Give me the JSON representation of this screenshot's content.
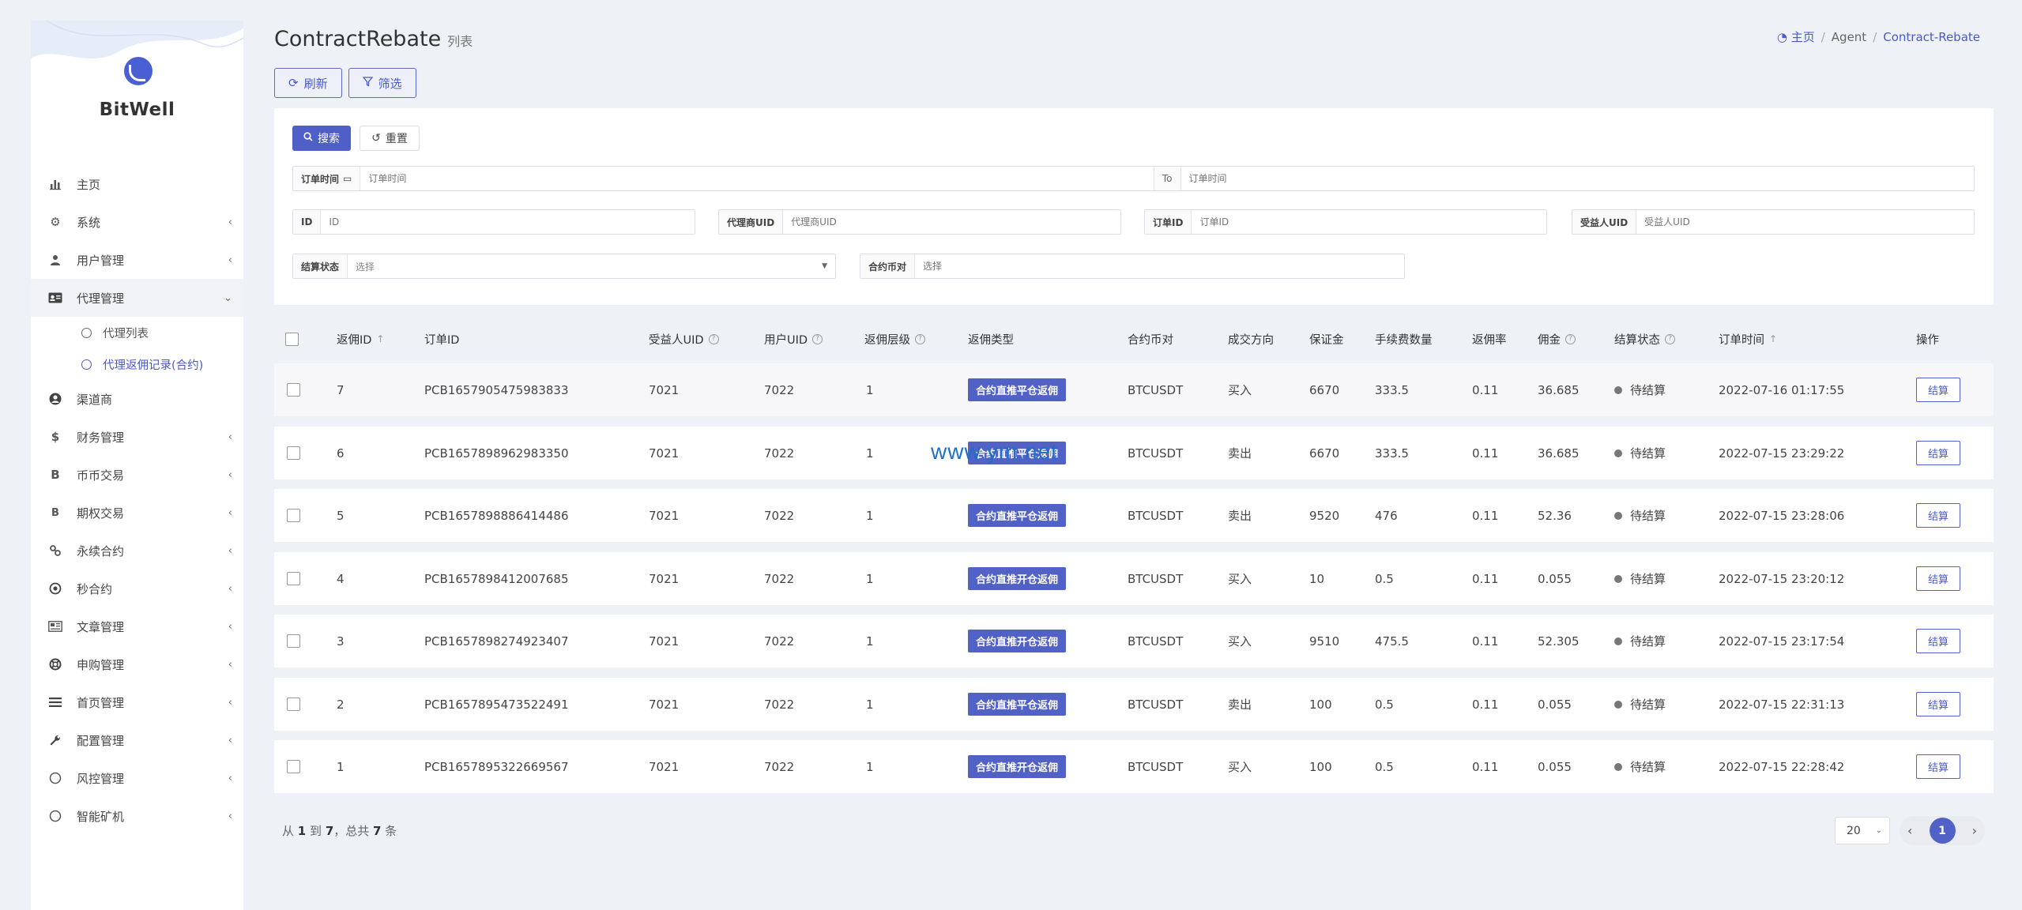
{
  "brand": {
    "name": "BitWell"
  },
  "sidebar": {
    "items": [
      {
        "label": "主页",
        "icon": "bar-chart-icon",
        "chevron": false
      },
      {
        "label": "系统",
        "icon": "gear-icon",
        "chevron": true
      },
      {
        "label": "用户管理",
        "icon": "users-icon",
        "chevron": true
      },
      {
        "label": "代理管理",
        "icon": "id-card-icon",
        "chevron": true,
        "open": true
      },
      {
        "label": "渠道商",
        "icon": "user-circle-icon",
        "chevron": false
      },
      {
        "label": "财务管理",
        "icon": "dollar-icon",
        "chevron": true
      },
      {
        "label": "币币交易",
        "icon": "bitcoin-icon",
        "chevron": true
      },
      {
        "label": "期权交易",
        "icon": "bitcoin-icon",
        "chevron": true
      },
      {
        "label": "永续合约",
        "icon": "link-icon",
        "chevron": true
      },
      {
        "label": "秒合约",
        "icon": "dot-circle-icon",
        "chevron": true
      },
      {
        "label": "文章管理",
        "icon": "newspaper-icon",
        "chevron": true
      },
      {
        "label": "申购管理",
        "icon": "lifebuoy-icon",
        "chevron": true
      },
      {
        "label": "首页管理",
        "icon": "list-icon",
        "chevron": true
      },
      {
        "label": "配置管理",
        "icon": "wrench-icon",
        "chevron": true
      },
      {
        "label": "风控管理",
        "icon": "circle-icon",
        "chevron": true
      },
      {
        "label": "智能矿机",
        "icon": "circle-icon",
        "chevron": true
      }
    ],
    "submenu": [
      {
        "label": "代理列表",
        "active": false
      },
      {
        "label": "代理返佣记录(合约)",
        "active": true
      }
    ]
  },
  "header": {
    "title": "ContractRebate",
    "subtitle": "列表",
    "breadcrumb": {
      "home": "主页",
      "middle": "Agent",
      "current": "Contract-Rebate"
    }
  },
  "toolbar": {
    "refresh_label": "刷新",
    "filter_label": "筛选"
  },
  "filters": {
    "search_label": "搜索",
    "reset_label": "重置",
    "order_time_label": "订单时间",
    "order_time_placeholder": "订单时间",
    "to_label": "To",
    "order_time_to_placeholder": "订单时间",
    "id_label": "ID",
    "id_placeholder": "ID",
    "agent_uid_label": "代理商UID",
    "agent_uid_placeholder": "代理商UID",
    "order_id_label": "订单ID",
    "order_id_placeholder": "订单ID",
    "beneficiary_uid_label": "受益人UID",
    "beneficiary_uid_placeholder": "受益人UID",
    "settle_status_label": "结算状态",
    "settle_status_value": "选择",
    "pair_label": "合约币对",
    "pair_placeholder": "选择"
  },
  "table": {
    "headers": {
      "rebate_id": "返佣ID",
      "order_id": "订单ID",
      "beneficiary_uid": "受益人UID",
      "user_uid": "用户UID",
      "level": "返佣层级",
      "type": "返佣类型",
      "pair": "合约币对",
      "direction": "成交方向",
      "margin": "保证金",
      "fee": "手续费数量",
      "rate": "返佣率",
      "commission": "佣金",
      "status": "结算状态",
      "order_time": "订单时间",
      "actions": "操作"
    },
    "action_label": "结算",
    "rows": [
      {
        "id": "7",
        "order_id": "PCB1657905475983833",
        "beneficiary_uid": "7021",
        "user_uid": "7022",
        "level": "1",
        "type": "合约直推平仓返佣",
        "pair": "BTCUSDT",
        "direction": "买入",
        "margin": "6670",
        "fee": "333.5",
        "rate": "0.11",
        "commission": "36.685",
        "status": "待结算",
        "time": "2022-07-16 01:17:55"
      },
      {
        "id": "6",
        "order_id": "PCB1657898962983350",
        "beneficiary_uid": "7021",
        "user_uid": "7022",
        "level": "1",
        "type": "合约直推平仓返佣",
        "pair": "BTCUSDT",
        "direction": "卖出",
        "margin": "6670",
        "fee": "333.5",
        "rate": "0.11",
        "commission": "36.685",
        "status": "待结算",
        "time": "2022-07-15 23:29:22"
      },
      {
        "id": "5",
        "order_id": "PCB1657898886414486",
        "beneficiary_uid": "7021",
        "user_uid": "7022",
        "level": "1",
        "type": "合约直推平仓返佣",
        "pair": "BTCUSDT",
        "direction": "卖出",
        "margin": "9520",
        "fee": "476",
        "rate": "0.11",
        "commission": "52.36",
        "status": "待结算",
        "time": "2022-07-15 23:28:06"
      },
      {
        "id": "4",
        "order_id": "PCB1657898412007685",
        "beneficiary_uid": "7021",
        "user_uid": "7022",
        "level": "1",
        "type": "合约直推开仓返佣",
        "pair": "BTCUSDT",
        "direction": "买入",
        "margin": "10",
        "fee": "0.5",
        "rate": "0.11",
        "commission": "0.055",
        "status": "待结算",
        "time": "2022-07-15 23:20:12"
      },
      {
        "id": "3",
        "order_id": "PCB1657898274923407",
        "beneficiary_uid": "7021",
        "user_uid": "7022",
        "level": "1",
        "type": "合约直推开仓返佣",
        "pair": "BTCUSDT",
        "direction": "买入",
        "margin": "9510",
        "fee": "475.5",
        "rate": "0.11",
        "commission": "52.305",
        "status": "待结算",
        "time": "2022-07-15 23:17:54"
      },
      {
        "id": "2",
        "order_id": "PCB1657895473522491",
        "beneficiary_uid": "7021",
        "user_uid": "7022",
        "level": "1",
        "type": "合约直推平仓返佣",
        "pair": "BTCUSDT",
        "direction": "卖出",
        "margin": "100",
        "fee": "0.5",
        "rate": "0.11",
        "commission": "0.055",
        "status": "待结算",
        "time": "2022-07-15 22:31:13"
      },
      {
        "id": "1",
        "order_id": "PCB1657895322669567",
        "beneficiary_uid": "7021",
        "user_uid": "7022",
        "level": "1",
        "type": "合约直推开仓返佣",
        "pair": "BTCUSDT",
        "direction": "买入",
        "margin": "100",
        "fee": "0.5",
        "rate": "0.11",
        "commission": "0.055",
        "status": "待结算",
        "time": "2022-07-15 22:28:42"
      }
    ]
  },
  "pagination": {
    "summary_prefix": "从",
    "summary_from": "1",
    "summary_to_word": "到",
    "summary_to": "7",
    "summary_total_word": "，总共",
    "summary_total": "7",
    "summary_suffix": "条",
    "page_size": "20",
    "current_page": "1"
  },
  "watermark": "www.ym.net",
  "colors": {
    "accent": "#5161c6",
    "background": "#eef1f6"
  }
}
